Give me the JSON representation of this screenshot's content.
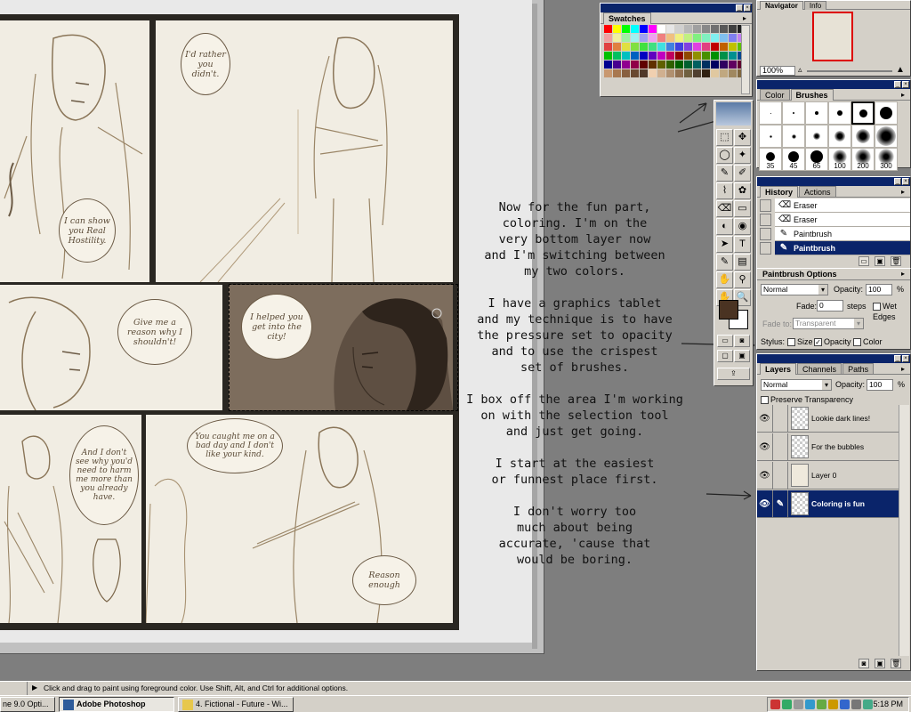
{
  "canvas": {
    "bubbles": [
      {
        "id": "b1",
        "text": "I'd rather you didn't."
      },
      {
        "id": "b2",
        "text": "I can show you Real Hostility."
      },
      {
        "id": "b3",
        "text": "Give me a reason why I shouldn't!"
      },
      {
        "id": "b4",
        "text": "I helped you get into the city!"
      },
      {
        "id": "b5",
        "text": "And I don't see why you'd need to harm me more than you already have."
      },
      {
        "id": "b6",
        "text": "You caught me on a bad day and I don't like your kind."
      },
      {
        "id": "b7",
        "text": "Reason enough"
      }
    ]
  },
  "tutorial": {
    "paragraphs": [
      "Now for the fun part,\ncoloring.  I'm on the\nvery bottom layer now\nand I'm switching between\nmy two colors.",
      "I have a graphics tablet\nand my technique is to have\nthe pressure set to opacity\nand to use the crispest\nset of brushes.",
      "I box off the area I'm working\non with the selection tool\nand just get going.",
      "I start at the easiest\nor funnest place first.",
      "I don't worry too\nmuch about being\naccurate, 'cause that\nwould be boring."
    ]
  },
  "swatches": {
    "tab": "Swatches",
    "colors": [
      "#ff0000",
      "#ffff00",
      "#00ff00",
      "#00ffff",
      "#0000ff",
      "#ff00ff",
      "#ffffff",
      "#e6e6e6",
      "#d0d0d0",
      "#b8b8b8",
      "#a0a0a0",
      "#888888",
      "#707070",
      "#585858",
      "#404040",
      "#202020",
      "#f0a0a0",
      "#f0f0a0",
      "#a0f0a0",
      "#a0f0f0",
      "#a0a0f0",
      "#f0a0f0",
      "#f08080",
      "#f0c080",
      "#f0f080",
      "#c0f080",
      "#80f080",
      "#80f0c0",
      "#80f0f0",
      "#80c0f0",
      "#8080f0",
      "#c080f0",
      "#e04040",
      "#e08040",
      "#e0e040",
      "#80e040",
      "#40e040",
      "#40e080",
      "#40e0e0",
      "#4080e0",
      "#4040e0",
      "#8040e0",
      "#e040e0",
      "#e04080",
      "#c00000",
      "#c06000",
      "#c0c000",
      "#60c000",
      "#00c000",
      "#00c060",
      "#00c0c0",
      "#0060c0",
      "#0000c0",
      "#6000c0",
      "#c000c0",
      "#c00060",
      "#900000",
      "#904800",
      "#909000",
      "#489000",
      "#009000",
      "#009048",
      "#009090",
      "#004890",
      "#000090",
      "#480090",
      "#900090",
      "#900048",
      "#600000",
      "#603000",
      "#606000",
      "#306000",
      "#006000",
      "#006030",
      "#006060",
      "#003060",
      "#000060",
      "#300060",
      "#600060",
      "#600030",
      "#c89870",
      "#a87850",
      "#886040",
      "#684830",
      "#503828",
      "#f0d0b0",
      "#d0b090",
      "#b09070",
      "#907050",
      "#706040",
      "#504030",
      "#302010",
      "#e0c8a0",
      "#c0a880",
      "#a08860",
      "#806840"
    ]
  },
  "navigator": {
    "tabs": [
      "Navigator",
      "Info"
    ],
    "zoom": "100%"
  },
  "brushes": {
    "tabs": [
      "Color",
      "Brushes"
    ],
    "row1": [
      1,
      2,
      4,
      6,
      9,
      14
    ],
    "row2": [
      3,
      5,
      8,
      12,
      16,
      22
    ],
    "row3_labels": [
      "35",
      "45",
      "65",
      "100",
      "200",
      "300"
    ]
  },
  "history": {
    "tabs": [
      "History",
      "Actions"
    ],
    "states": [
      {
        "name": "Eraser",
        "icon": "eraser-icon"
      },
      {
        "name": "Eraser",
        "icon": "eraser-icon"
      },
      {
        "name": "Paintbrush",
        "icon": "paintbrush-icon"
      },
      {
        "name": "Paintbrush",
        "icon": "paintbrush-icon",
        "selected": true
      }
    ]
  },
  "paintbrush_options": {
    "title": "Paintbrush Options",
    "mode": "Normal",
    "opacity_label": "Opacity:",
    "opacity": "100",
    "percent": "%",
    "fade_label": "Fade:",
    "fade": "0",
    "steps_label": "steps",
    "wet_edges": "Wet Edges",
    "fade_to_label": "Fade to:",
    "fade_to": "Transparent",
    "stylus_label": "Stylus:",
    "stylus_size": "Size",
    "stylus_opacity": "Opacity",
    "stylus_color": "Color"
  },
  "layers": {
    "tabs": [
      "Layers",
      "Channels",
      "Paths"
    ],
    "mode": "Normal",
    "opacity_label": "Opacity:",
    "opacity": "100",
    "percent": "%",
    "preserve_transparency": "Preserve Transparency",
    "items": [
      {
        "name": "Lookie dark lines!"
      },
      {
        "name": "For the bubbles"
      },
      {
        "name": "Layer 0"
      },
      {
        "name": "Coloring is fun",
        "selected": true
      }
    ]
  },
  "toolbox": {
    "tools": [
      "⬚",
      "✥",
      "◯",
      "✦",
      "✎",
      "✐",
      "⌇",
      "✿",
      "⌫",
      "▭",
      "◐",
      "◉",
      "➤",
      "T",
      "✎",
      "▤",
      "✋",
      "⚲",
      "✋",
      "🔍"
    ]
  },
  "colors": {
    "foreground": "#4a3322",
    "background": "#ffffff",
    "title_bar": "#0a246a"
  },
  "status_bar": {
    "message": "Click and drag to paint using foreground color.  Use Shift, Alt, and Ctrl for additional options."
  },
  "taskbar": {
    "items": [
      {
        "label": "ne 9.0 Opti..."
      },
      {
        "label": "Adobe Photoshop",
        "active": true
      },
      {
        "label": "4. Fictional - Future - Wi..."
      }
    ],
    "clock": "5:18 PM"
  }
}
